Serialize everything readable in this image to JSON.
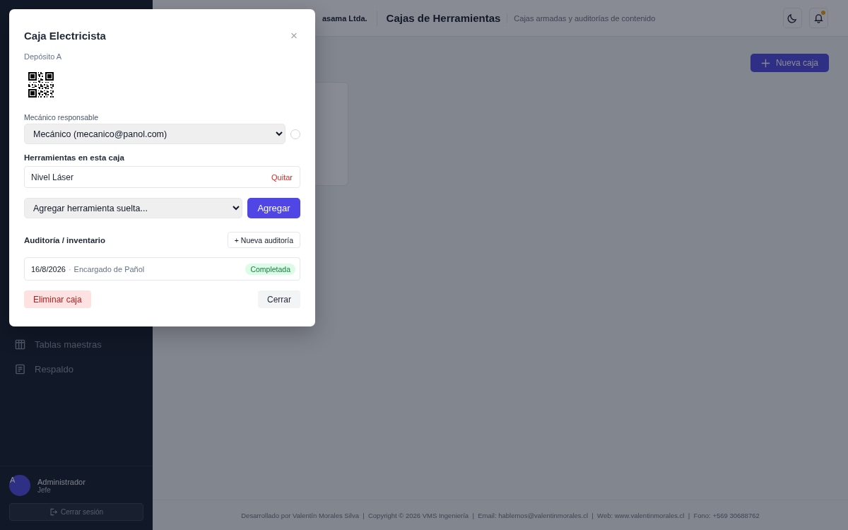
{
  "sidebar": {
    "items": [
      {
        "label": "Tablas maestras",
        "kind": "table"
      },
      {
        "label": "Respaldo",
        "kind": "document"
      }
    ],
    "user": {
      "initial": "A",
      "name": "Administrador",
      "role": "Jefe"
    },
    "logout": "Cerrar sesión"
  },
  "header": {
    "company": "asama Ltda.",
    "title": "Cajas de Herramientas",
    "subtitle": "Cajas armadas y auditorías de contenido",
    "notification_dot": true
  },
  "toolbar": {
    "new_button": "Nueva caja"
  },
  "footer": "Desarrollado por Valentín Morales Silva  |  Copyright © 2026 VMS Ingeniería  |  Email: hablemos@valentinmorales.cl  |  Web: www.valentinmorales.cl  |  Fono: +569 30688762",
  "modal": {
    "title": "Caja Electricista",
    "close": "×",
    "location": "Depósito A",
    "mechanic_label": "Mecánico responsable",
    "mechanic_value": "Mecánico (mecanico@panol.com)",
    "tools_heading": "Herramientas en esta caja",
    "tools": [
      {
        "name": "Nivel Láser",
        "remove": "Quitar"
      }
    ],
    "add_placeholder": "Agregar herramienta suelta...",
    "add_button": "Agregar",
    "audit_heading": "Auditoría / inventario",
    "new_audit": "+ Nueva auditoría",
    "audits": [
      {
        "date": "16/8/2026",
        "separator": "·",
        "by": "Encargado de Pañol",
        "status": "Completada",
        "kind": "completed"
      }
    ],
    "delete_button": "Eliminar caja",
    "close_button": "Cerrar"
  }
}
